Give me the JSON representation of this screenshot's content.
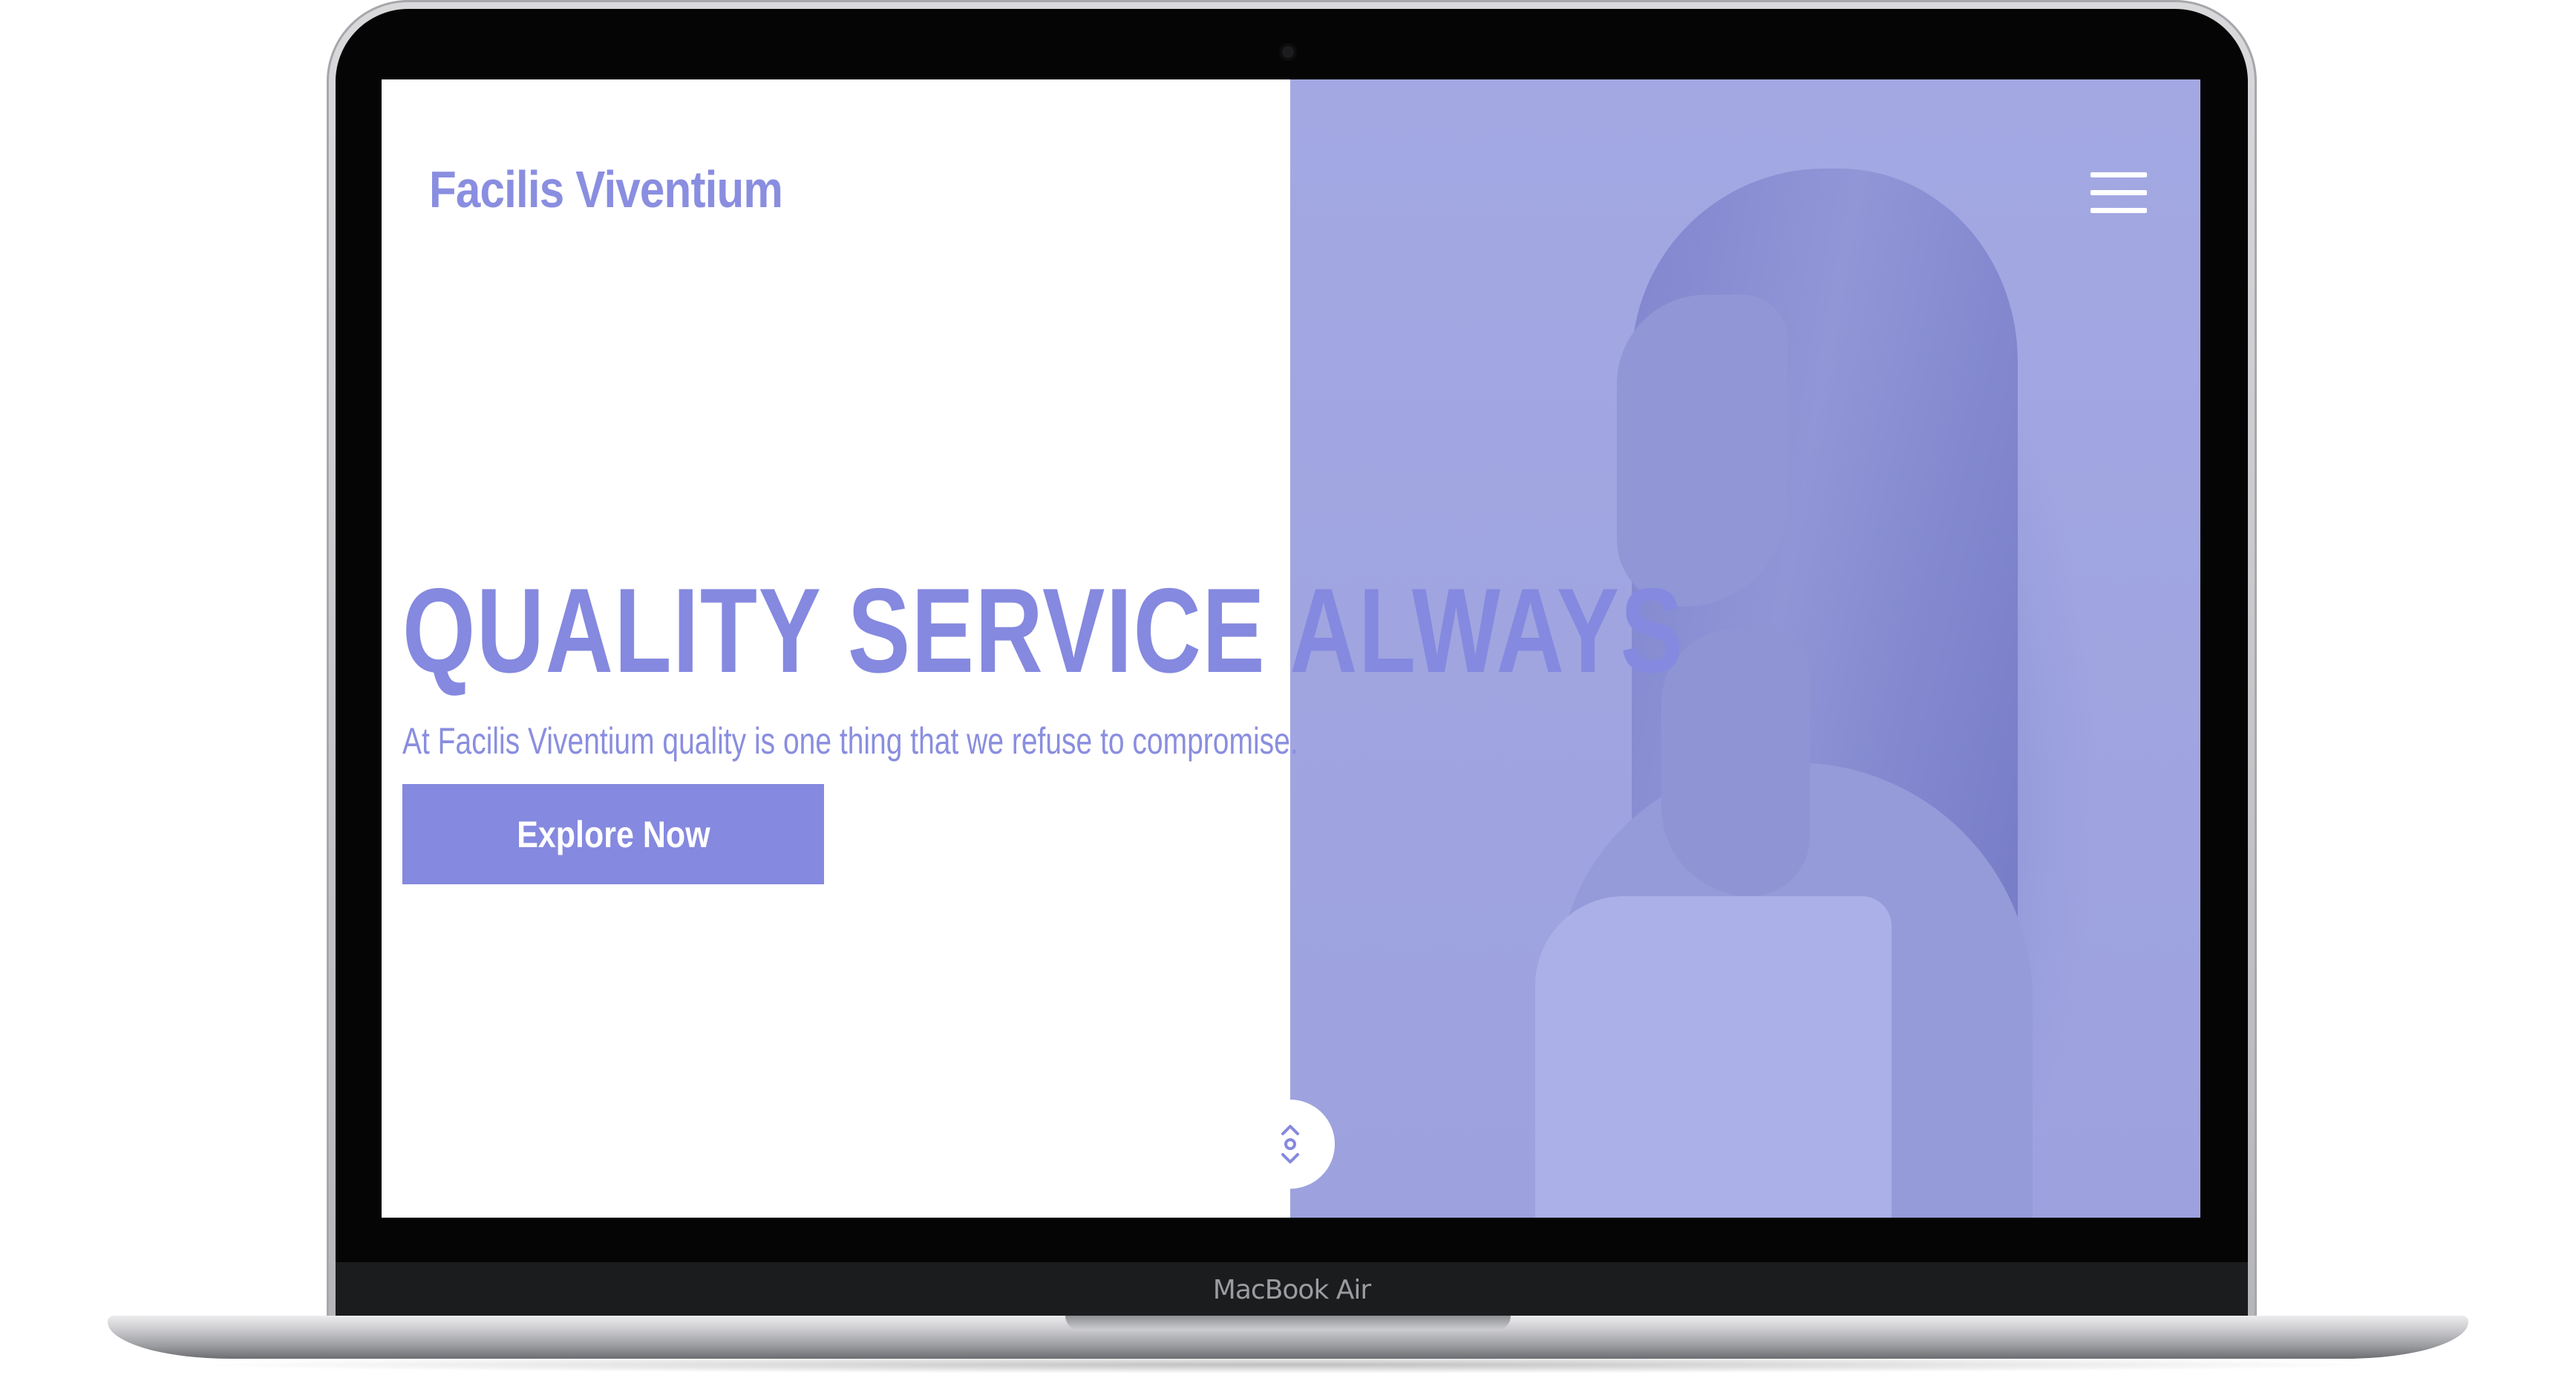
{
  "device": {
    "model_label": "MacBook Air"
  },
  "site": {
    "brand": "Facilis Viventium",
    "menu_icon": "hamburger-menu-icon"
  },
  "hero": {
    "title": "QUALITY SERVICE ALWAYS",
    "subtitle": "At Facilis Viventium quality is one thing that we refuse to compromise.",
    "cta_label": "Explore Now",
    "scroll_icon": "scroll-down-icon"
  },
  "colors": {
    "accent": "#8589df",
    "image_tint": "#a3a8e3",
    "background": "#ffffff"
  }
}
